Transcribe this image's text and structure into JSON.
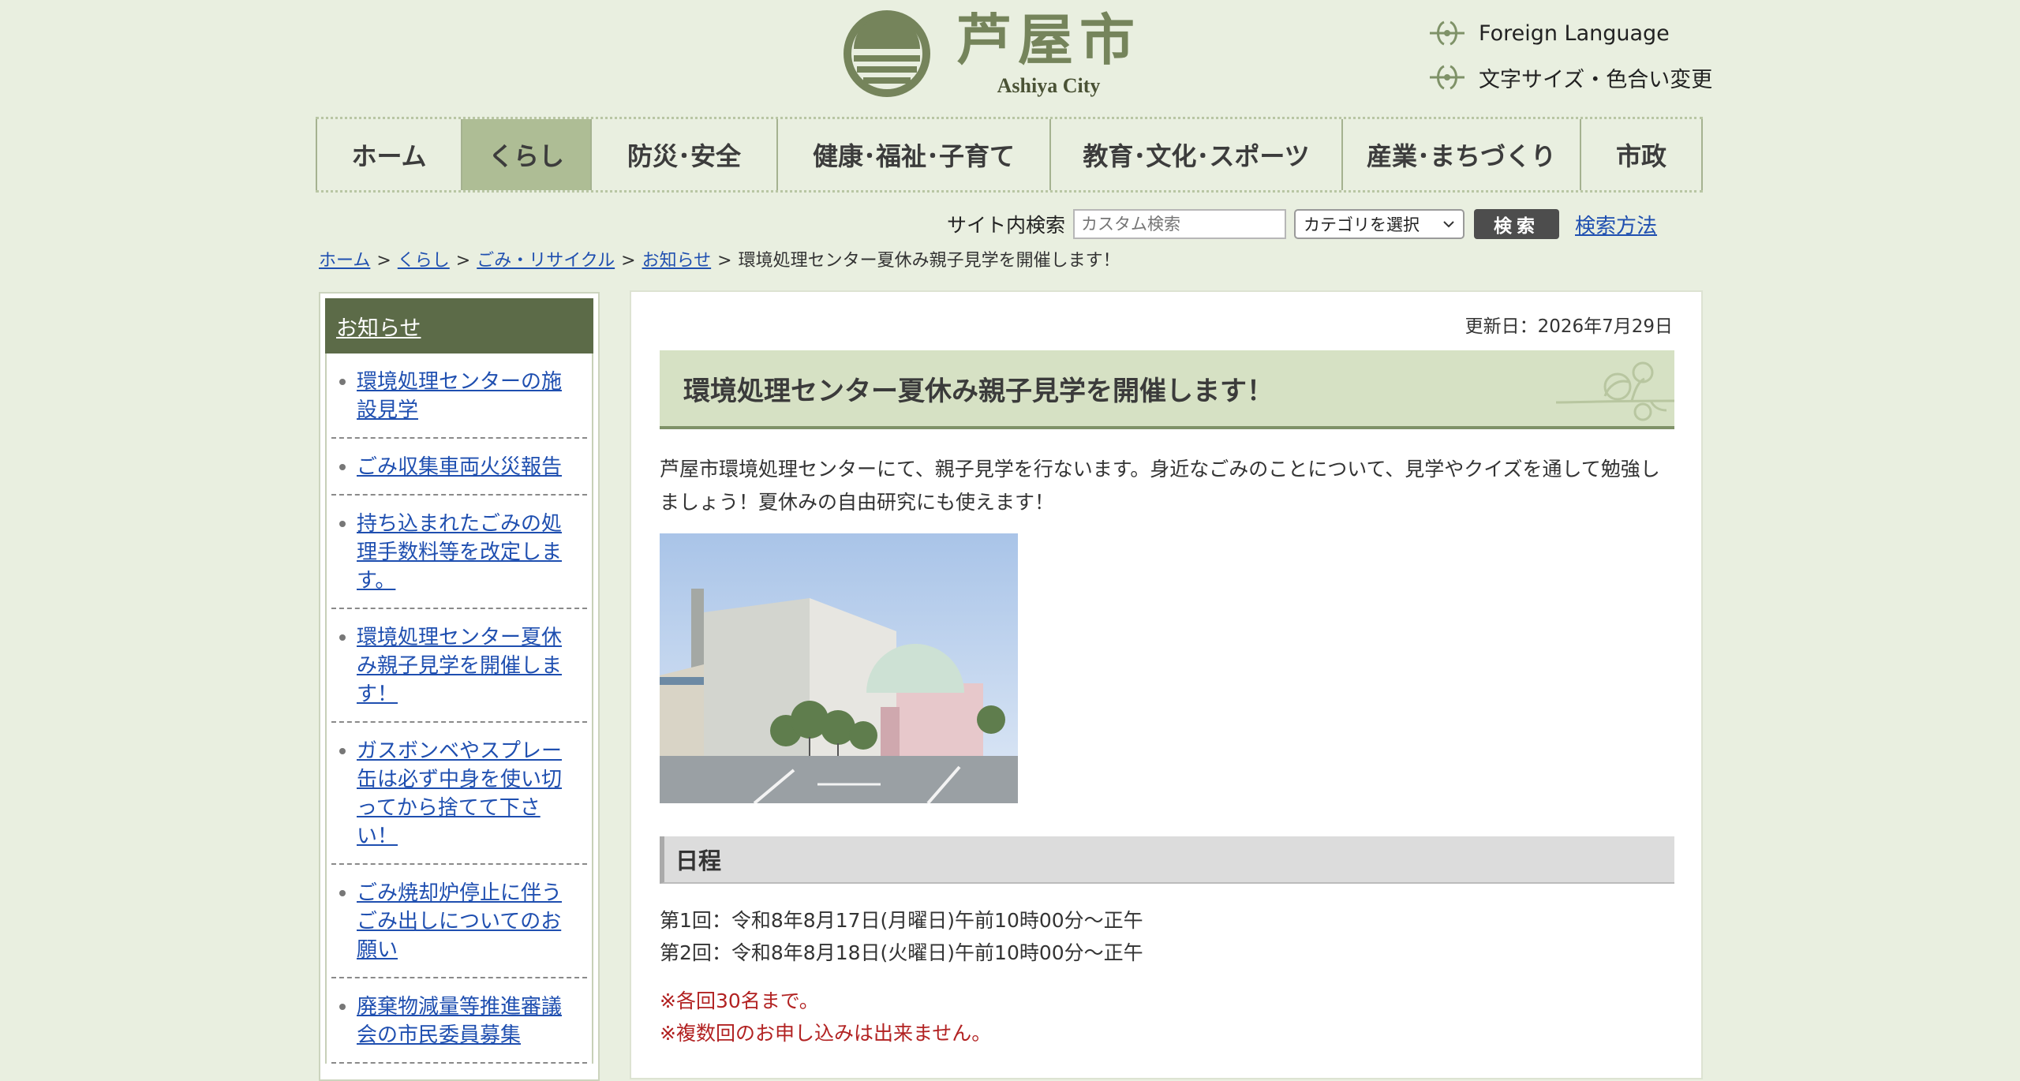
{
  "header": {
    "logo_jp": "芦屋市",
    "logo_en": "Ashiya City",
    "utility": [
      {
        "label": "Foreign Language"
      },
      {
        "label": "文字サイズ・色合い変更"
      }
    ]
  },
  "nav": {
    "items": [
      {
        "label": "ホーム"
      },
      {
        "label": "くらし"
      },
      {
        "label": "防災･安全"
      },
      {
        "label": "健康･福祉･子育て"
      },
      {
        "label": "教育･文化･スポーツ"
      },
      {
        "label": "産業･まちづくり"
      },
      {
        "label": "市政"
      }
    ],
    "active": "くらし"
  },
  "search": {
    "label": "サイト内検索",
    "placeholder": "カスタム検索",
    "category_selected": "カテゴリを選択",
    "button": "検索",
    "help": "検索方法"
  },
  "breadcrumb": {
    "items": [
      "ホーム",
      "くらし",
      "ごみ・リサイクル",
      "お知らせ"
    ],
    "current": "環境処理センター夏休み親子見学を開催します！",
    "separator": ">"
  },
  "sidebar": {
    "heading": "お知らせ",
    "items": [
      {
        "label": "環境処理センターの施設見学"
      },
      {
        "label": "ごみ収集車両火災報告"
      },
      {
        "label": "持ち込まれたごみの処理手数料等を改定します。"
      },
      {
        "label": "環境処理センター夏休み親子見学を開催します！"
      },
      {
        "label": "ガスボンベやスプレー缶は必ず中身を使い切ってから捨てて下さい！"
      },
      {
        "label": "ごみ焼却炉停止に伴うごみ出しについてのお願い"
      },
      {
        "label": "廃棄物減量等推進審議会の市民委員募集"
      }
    ]
  },
  "main": {
    "updated": "更新日：2026年7月29日",
    "title": "環境処理センター夏休み親子見学を開催します！",
    "lead": "芦屋市環境処理センターにて、親子見学を行ないます。身近なごみのことについて、見学やクイズを通して勉強しましょう！夏休みの自由研究にも使えます！",
    "section_heading": "日程",
    "schedule": [
      "第1回：令和8年8月17日(月曜日)午前10時00分～正午",
      "第2回：令和8年8月18日(火曜日)午前10時00分～正午"
    ],
    "notes": [
      "※各回30名まで。",
      "※複数回のお申し込みは出来ません。"
    ]
  },
  "colors": {
    "page_bg": "#e9efe0",
    "nav_active": "#aebd95",
    "sidebar_head": "#5c6b48",
    "title_bar": "#d6e1c4",
    "link": "#1f4fb0",
    "note_red": "#b22222"
  },
  "icons": {
    "logo": "ashiya-city-emblem",
    "utility": "fleur-ornament-icon",
    "select": "chevron-down-icon"
  }
}
